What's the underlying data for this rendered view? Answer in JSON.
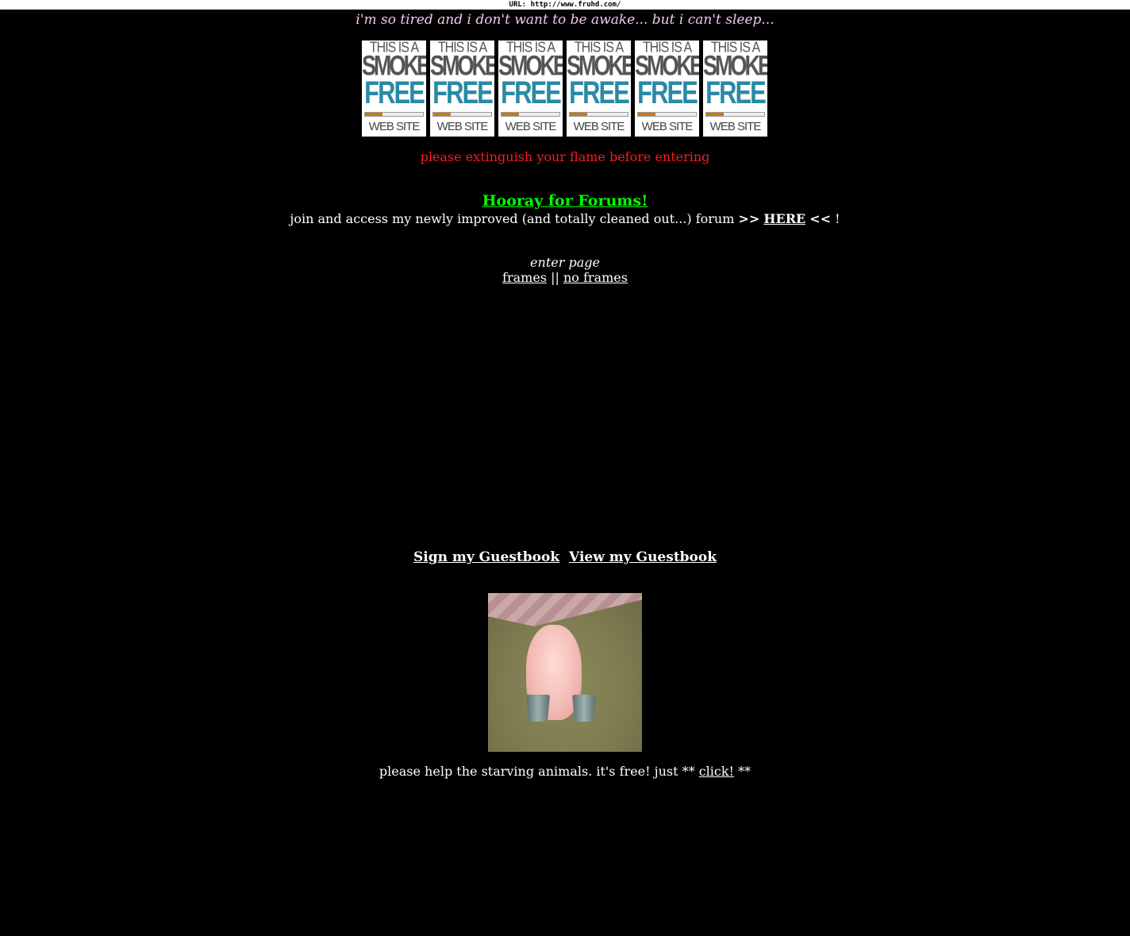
{
  "url_bar": "URL: http://www.fruhd.com/",
  "tagline": "i'm so tired and i don't want to be awake... but i can't sleep...",
  "banner": {
    "line1": "THIS IS A",
    "line2": "SMOKE",
    "line3": "FREE",
    "line4": "WEB SITE",
    "count": 6
  },
  "warning": "please extinguish your flame before entering",
  "forum": {
    "title": "Hooray for Forums!",
    "text_before": "join and access my newly improved (and totally cleaned out...) forum ",
    "arrows_left": ">>",
    "link": "HERE",
    "arrows_right": "<<",
    "text_after": " !"
  },
  "enter": {
    "label": "enter page",
    "frames": "frames",
    "separator": "||",
    "no_frames": "no frames"
  },
  "guestbook": {
    "sign": "Sign my Guestbook",
    "view": "View my Guestbook"
  },
  "help": {
    "text": "please help the starving animals. it's free! just ** ",
    "link": "click!",
    "suffix": " **"
  },
  "colors": {
    "background": "#000000",
    "tagline": "#f2c8ee",
    "warning": "#ff1a1a",
    "forum_title": "#00ff00",
    "banner_free": "#2a8aa6"
  }
}
